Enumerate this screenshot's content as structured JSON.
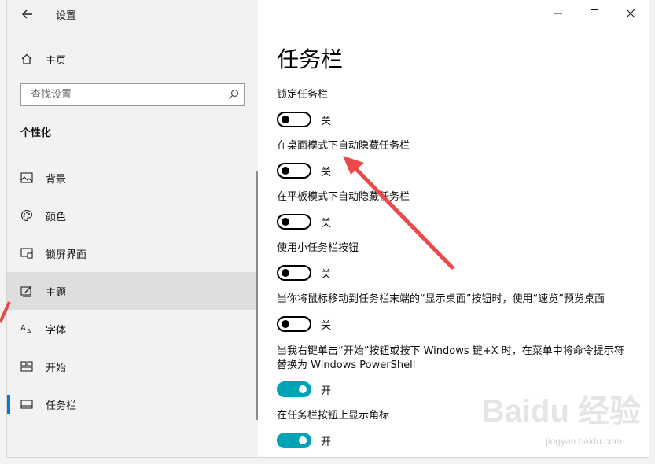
{
  "window": {
    "title": "设置"
  },
  "sidebar": {
    "home_label": "主页",
    "search_placeholder": "查找设置",
    "section_title": "个性化",
    "items": [
      {
        "label": "背景",
        "icon": "image-icon"
      },
      {
        "label": "颜色",
        "icon": "palette-icon"
      },
      {
        "label": "锁屏界面",
        "icon": "lockscreen-icon"
      },
      {
        "label": "主题",
        "icon": "theme-icon"
      },
      {
        "label": "字体",
        "icon": "font-icon"
      },
      {
        "label": "开始",
        "icon": "start-icon"
      },
      {
        "label": "任务栏",
        "icon": "taskbar-icon"
      }
    ]
  },
  "main": {
    "title": "任务栏",
    "settings": [
      {
        "label": "锁定任务栏",
        "state": "关",
        "on": false
      },
      {
        "label": "在桌面模式下自动隐藏任务栏",
        "state": "关",
        "on": false
      },
      {
        "label": "在平板模式下自动隐藏任务栏",
        "state": "关",
        "on": false
      },
      {
        "label": "使用小任务栏按钮",
        "state": "关",
        "on": false
      },
      {
        "label": "当你将鼠标移动到任务栏末端的“显示桌面”按钮时，使用“速览”预览桌面",
        "state": "关",
        "on": false
      },
      {
        "label": "当我右键单击“开始”按钮或按下 Windows 键+X 时，在菜单中将命令提示符替换为 Windows PowerShell",
        "state": "开",
        "on": true
      },
      {
        "label": "在任务栏按钮上显示角标",
        "state": "开",
        "on": true
      }
    ]
  },
  "watermark": {
    "brand": "Baidu 经验",
    "url": "jingyan.baidu.com"
  },
  "colors": {
    "accent": "#0078d7",
    "toggle_on": "#00a3b5",
    "annotation_arrow": "#e84a4a"
  }
}
